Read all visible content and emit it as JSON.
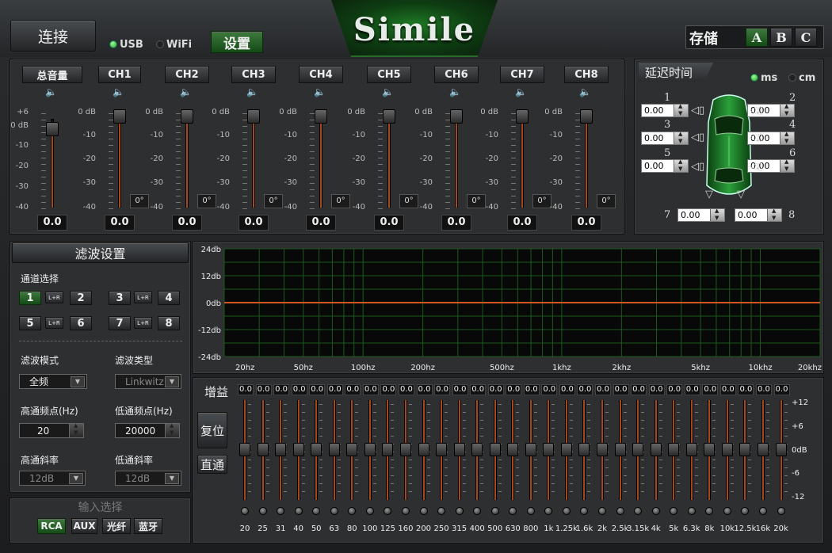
{
  "header": {
    "connect_label": "连接",
    "usb_label": "USB",
    "wifi_label": "WiFi",
    "settings_label": "设置",
    "logo": "Simile",
    "save_label": "存储",
    "presets": [
      "A",
      "B",
      "C"
    ]
  },
  "mixer": {
    "master_label": "总音量",
    "channels": [
      "CH1",
      "CH2",
      "CH3",
      "CH4",
      "CH5",
      "CH6",
      "CH7",
      "CH8"
    ],
    "master_scale": [
      "+6",
      "0 dB",
      "-10",
      "-20",
      "-30",
      "-40"
    ],
    "ch_scale": [
      "0 dB",
      "-10",
      "-20",
      "-30",
      "-40"
    ],
    "master_value": "0.0",
    "values": [
      "0.0",
      "0.0",
      "0.0",
      "0.0",
      "0.0",
      "0.0",
      "0.0",
      "0.0"
    ],
    "phase": "0°"
  },
  "delay": {
    "title": "延迟时间",
    "ms_label": "ms",
    "cm_label": "cm",
    "channels": [
      {
        "num": "1",
        "value": "0.00"
      },
      {
        "num": "2",
        "value": "0.00"
      },
      {
        "num": "3",
        "value": "0.00"
      },
      {
        "num": "4",
        "value": "0.00"
      },
      {
        "num": "5",
        "value": "0.00"
      },
      {
        "num": "6",
        "value": "0.00"
      },
      {
        "num": "7",
        "value": "0.00"
      },
      {
        "num": "8",
        "value": "0.00"
      }
    ]
  },
  "filter": {
    "title": "滤波设置",
    "channel_select_label": "通道选择",
    "lr_label": "L+R",
    "ch_buttons": [
      "1",
      "2",
      "3",
      "4",
      "5",
      "6",
      "7",
      "8"
    ],
    "mode_label": "滤波模式",
    "mode_value": "全频",
    "type_label": "滤波类型",
    "type_value": "Linkwitz",
    "hp_freq_label": "高通频点(Hz)",
    "hp_freq_value": "20",
    "lp_freq_label": "低通频点(Hz)",
    "lp_freq_value": "20000",
    "hp_slope_label": "高通斜率",
    "hp_slope_value": "12dB",
    "lp_slope_label": "低通斜率",
    "lp_slope_value": "12dB"
  },
  "input": {
    "title": "输入选择",
    "options": [
      "RCA",
      "AUX",
      "光纤",
      "蓝牙"
    ]
  },
  "graph": {
    "y_labels": [
      "24db",
      "12db",
      "0db",
      "-12db",
      "-24db"
    ],
    "x_labels": [
      "20hz",
      "50hz",
      "100hz",
      "200hz",
      "500hz",
      "1khz",
      "2khz",
      "5khz",
      "10khz",
      "20khz"
    ],
    "line_color": "#d0581e"
  },
  "geq": {
    "gain_label": "增益",
    "reset_label": "复位",
    "bypass_label": "直通",
    "scale": [
      "+12",
      "+6",
      "0dB",
      "-6",
      "-12"
    ],
    "values": [
      "0.0",
      "0.0",
      "0.0",
      "0.0",
      "0.0",
      "0.0",
      "0.0",
      "0.0",
      "0.0",
      "0.0",
      "0.0",
      "0.0",
      "0.0",
      "0.0",
      "0.0",
      "0.0",
      "0.0",
      "0.0",
      "0.0",
      "0.0",
      "0.0",
      "0.0",
      "0.0",
      "0.0",
      "0.0",
      "0.0",
      "0.0",
      "0.0",
      "0.0",
      "0.0",
      "0.0"
    ],
    "freqs": [
      "20",
      "25",
      "31",
      "40",
      "50",
      "63",
      "80",
      "100",
      "125",
      "160",
      "200",
      "250",
      "315",
      "400",
      "500",
      "630",
      "800",
      "1k",
      "1.25k",
      "1.6k",
      "2k",
      "2.5k",
      "3.15k",
      "4k",
      "5k",
      "6.3k",
      "8k",
      "10k",
      "12.5k",
      "16k",
      "20k"
    ]
  }
}
